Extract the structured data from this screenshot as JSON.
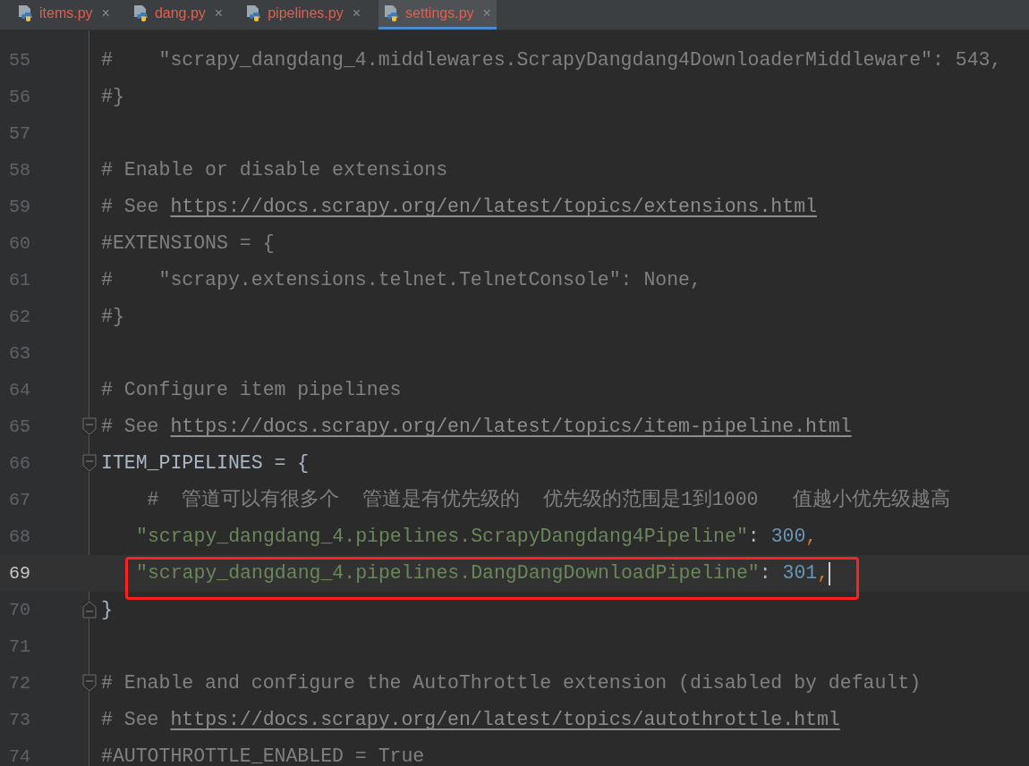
{
  "tabs": [
    {
      "label": "items.py",
      "close": "×",
      "selected": false
    },
    {
      "label": "dang.py",
      "close": "×",
      "selected": false
    },
    {
      "label": "pipelines.py",
      "close": "×",
      "selected": false
    },
    {
      "label": "settings.py",
      "close": "×",
      "selected": true
    }
  ],
  "lines": [
    {
      "number": "55",
      "current": false,
      "fold_start": false,
      "fold_end": false,
      "indented": false,
      "highlighted": false,
      "caret": false,
      "tokens": [
        {
          "kind": "comment",
          "text": "#    \"scrapy_dangdang_4.middlewares.ScrapyDangdang4DownloaderMiddleware\": 543,"
        }
      ]
    },
    {
      "number": "56",
      "current": false,
      "fold_start": false,
      "fold_end": false,
      "indented": false,
      "highlighted": false,
      "caret": false,
      "tokens": [
        {
          "kind": "comment",
          "text": "#}"
        }
      ]
    },
    {
      "number": "57",
      "current": false,
      "fold_start": false,
      "fold_end": false,
      "indented": false,
      "highlighted": false,
      "caret": false
    },
    {
      "number": "58",
      "current": false,
      "fold_start": false,
      "fold_end": false,
      "indented": false,
      "highlighted": false,
      "caret": false,
      "tokens": [
        {
          "kind": "comment",
          "text": "# Enable or disable extensions"
        }
      ]
    },
    {
      "number": "59",
      "current": false,
      "fold_start": false,
      "fold_end": false,
      "indented": false,
      "highlighted": false,
      "caret": false,
      "tokens": [
        {
          "kind": "comment",
          "text": "# See "
        },
        {
          "kind": "link",
          "text": "https://docs.scrapy.org/en/latest/topics/extensions.html"
        }
      ]
    },
    {
      "number": "60",
      "current": false,
      "fold_start": false,
      "fold_end": false,
      "indented": false,
      "highlighted": false,
      "caret": false,
      "tokens": [
        {
          "kind": "comment",
          "text": "#EXTENSIONS = {"
        }
      ]
    },
    {
      "number": "61",
      "current": false,
      "fold_start": false,
      "fold_end": false,
      "indented": false,
      "highlighted": false,
      "caret": false,
      "tokens": [
        {
          "kind": "comment",
          "text": "#    \"scrapy.extensions.telnet.TelnetConsole\": None,"
        }
      ]
    },
    {
      "number": "62",
      "current": false,
      "fold_start": false,
      "fold_end": false,
      "indented": false,
      "highlighted": false,
      "caret": false,
      "tokens": [
        {
          "kind": "comment",
          "text": "#}"
        }
      ]
    },
    {
      "number": "63",
      "current": false,
      "fold_start": false,
      "fold_end": false,
      "indented": false,
      "highlighted": false,
      "caret": false
    },
    {
      "number": "64",
      "current": false,
      "fold_start": false,
      "fold_end": false,
      "indented": false,
      "highlighted": false,
      "caret": false,
      "tokens": [
        {
          "kind": "comment",
          "text": "# Configure item pipelines"
        }
      ]
    },
    {
      "number": "65",
      "current": false,
      "fold_start": true,
      "fold_end": false,
      "indented": false,
      "highlighted": false,
      "caret": false,
      "tokens": [
        {
          "kind": "comment",
          "text": "# See "
        },
        {
          "kind": "link",
          "text": "https://docs.scrapy.org/en/latest/topics/item-pipeline.html"
        }
      ]
    },
    {
      "number": "66",
      "current": false,
      "fold_start": true,
      "fold_end": false,
      "indented": false,
      "highlighted": false,
      "caret": false,
      "tokens": [
        {
          "kind": "plain",
          "text": "ITEM_PIPELINES = {"
        }
      ]
    },
    {
      "number": "67",
      "current": false,
      "fold_start": false,
      "fold_end": false,
      "indented": false,
      "highlighted": false,
      "caret": false,
      "tokens": [
        {
          "kind": "comment",
          "text": "    #  管道可以有很多个  管道是有优先级的  优先级的范围是1到1000   值越小优先级越高"
        }
      ]
    },
    {
      "number": "68",
      "current": false,
      "fold_start": false,
      "fold_end": false,
      "indented": true,
      "highlighted": false,
      "caret": false,
      "tokens": [
        {
          "kind": "string",
          "text": "\"scrapy_dangdang_4.pipelines.ScrapyDangdang4Pipeline\""
        },
        {
          "kind": "plain",
          "text": ": "
        },
        {
          "kind": "number",
          "text": "300"
        },
        {
          "kind": "punct",
          "text": ","
        }
      ]
    },
    {
      "number": "69",
      "current": true,
      "fold_start": false,
      "fold_end": false,
      "indented": true,
      "highlighted": true,
      "caret": true,
      "tokens": [
        {
          "kind": "string",
          "text": "\"scrapy_dangdang_4.pipelines.DangDangDownloadPipeline\""
        },
        {
          "kind": "plain",
          "text": ": "
        },
        {
          "kind": "number",
          "text": "301"
        },
        {
          "kind": "punct",
          "text": ","
        }
      ]
    },
    {
      "number": "70",
      "current": false,
      "fold_start": false,
      "fold_end": true,
      "indented": false,
      "highlighted": false,
      "caret": false,
      "tokens": [
        {
          "kind": "plain",
          "text": "}"
        }
      ]
    },
    {
      "number": "71",
      "current": false,
      "fold_start": false,
      "fold_end": false,
      "indented": false,
      "highlighted": false,
      "caret": false
    },
    {
      "number": "72",
      "current": false,
      "fold_start": true,
      "fold_end": false,
      "indented": false,
      "highlighted": false,
      "caret": false,
      "tokens": [
        {
          "kind": "comment",
          "text": "# Enable and configure the AutoThrottle extension (disabled by default)"
        }
      ]
    },
    {
      "number": "73",
      "current": false,
      "fold_start": false,
      "fold_end": false,
      "indented": false,
      "highlighted": false,
      "caret": false,
      "tokens": [
        {
          "kind": "comment",
          "text": "# See "
        },
        {
          "kind": "link",
          "text": "https://docs.scrapy.org/en/latest/topics/autothrottle.html"
        }
      ]
    },
    {
      "number": "74",
      "current": false,
      "fold_start": false,
      "fold_end": false,
      "indented": false,
      "highlighted": false,
      "caret": false,
      "tokens": [
        {
          "kind": "comment",
          "text": "#AUTOTHROTTLE_ENABLED = True"
        }
      ]
    }
  ]
}
